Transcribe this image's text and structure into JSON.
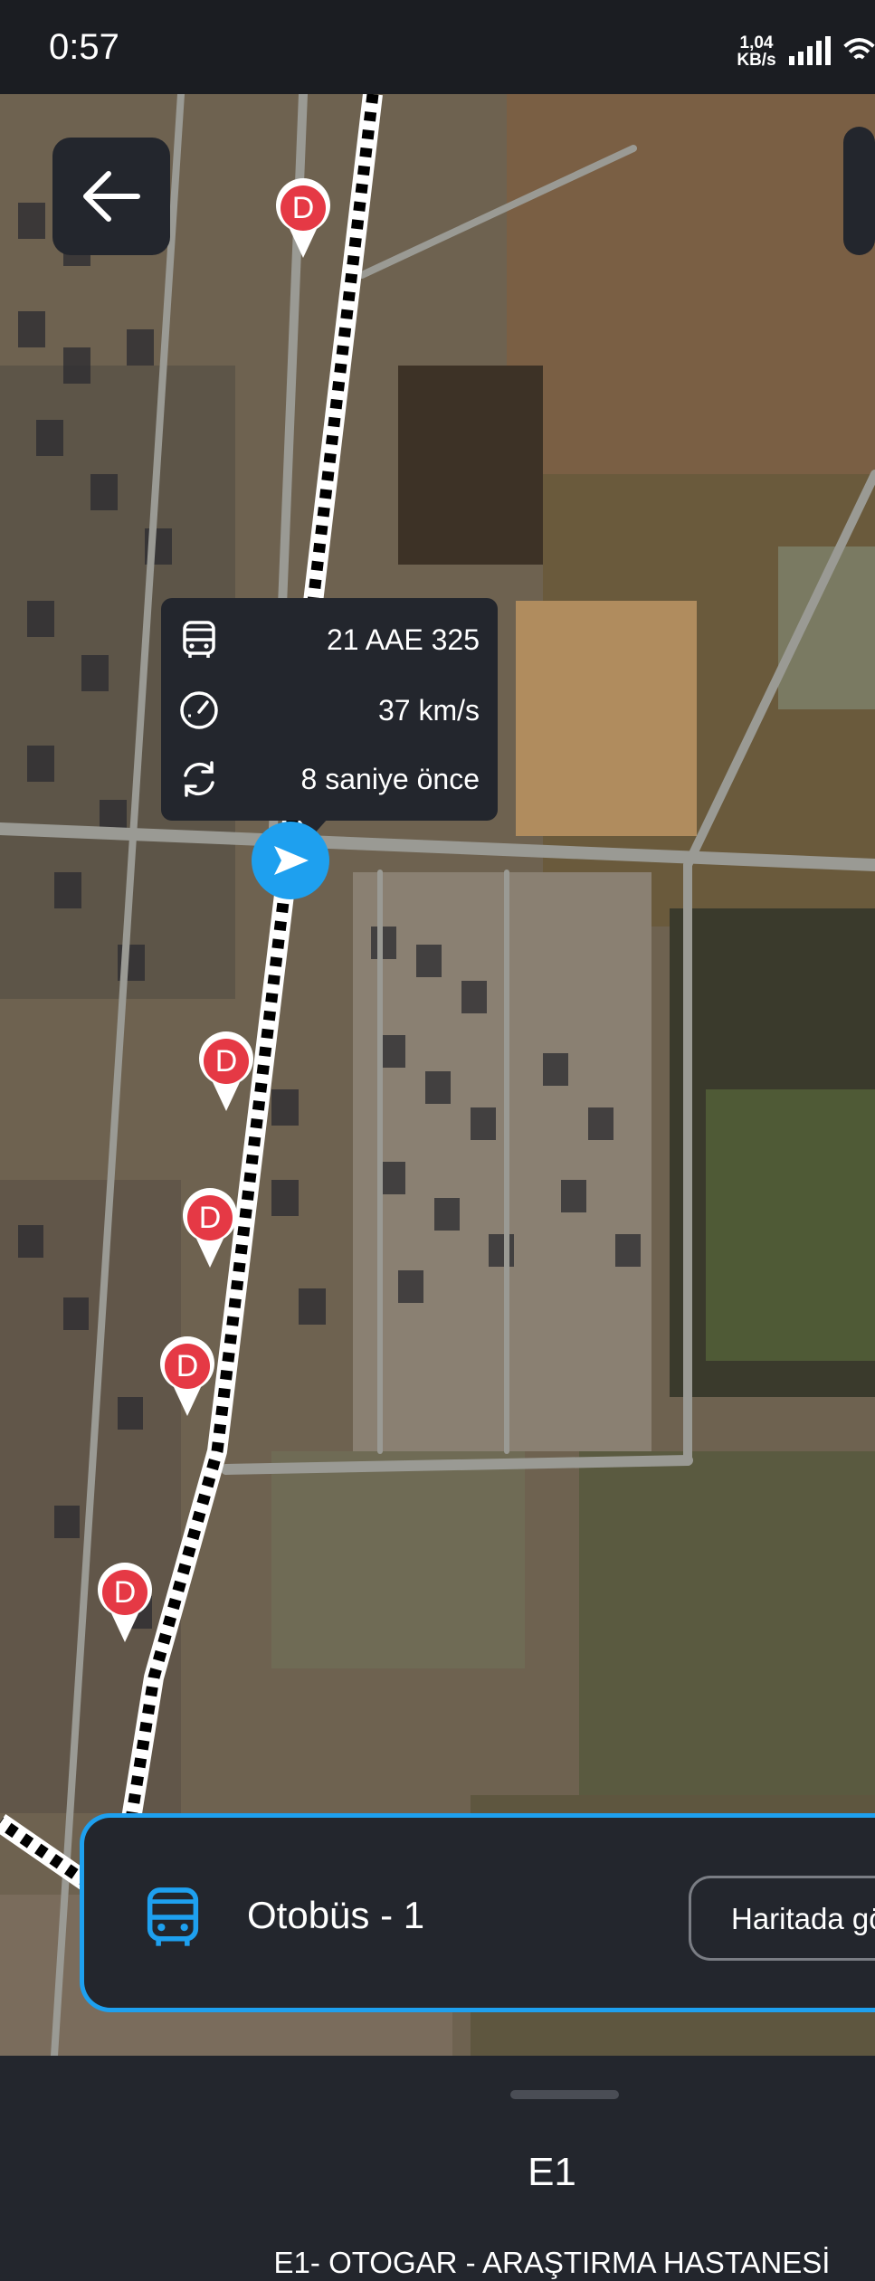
{
  "status_bar": {
    "time": "0:57",
    "net_speed_value": "1,04",
    "net_speed_unit": "KB/s",
    "signal_icon": "signal-bars-icon",
    "wifi_icon": "wifi-icon"
  },
  "map": {
    "stop_label": "D",
    "stop_count": 5,
    "back_icon": "arrow-left-icon"
  },
  "bus_info": {
    "plate": "21 AAE 325",
    "speed": "37 km/s",
    "updated": "8 saniye önce",
    "icons": [
      "bus-icon",
      "speedometer-icon",
      "refresh-icon"
    ]
  },
  "bus_card": {
    "title": "Otobüs - 1",
    "button_label": "Haritada gö",
    "accent_color": "#1ea0ef"
  },
  "bottom_sheet": {
    "route_code": "E1",
    "route_name": "E1- OTOGAR - ARAŞTIRMA HASTANESİ"
  },
  "colors": {
    "background": "#1b1d22",
    "panel": "#23262d",
    "accent": "#1ea0ef",
    "stop_red": "#e53945"
  }
}
